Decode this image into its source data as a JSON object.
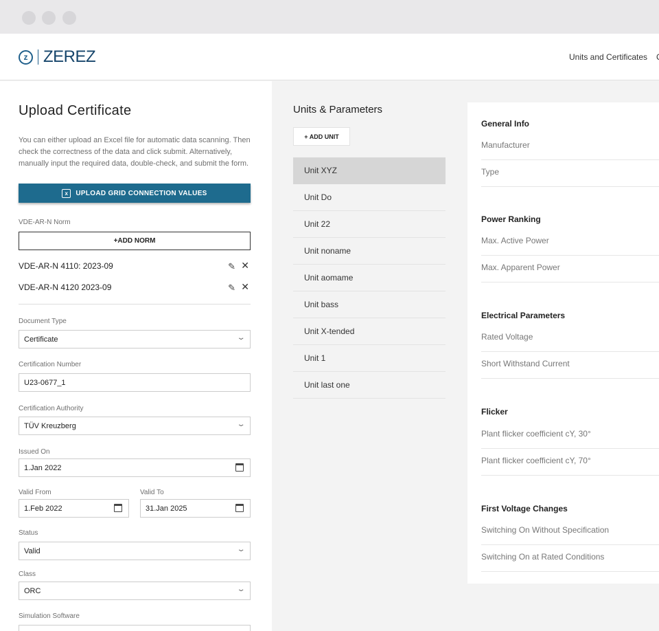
{
  "brand": {
    "logo_mark": "z",
    "name": "ZEREZ"
  },
  "nav": {
    "units_link": "Units and Certificates",
    "next_link": "C"
  },
  "upload": {
    "title": "Upload Certificate",
    "description": "You can either upload an Excel file for automatic data scanning. Then check the correctness of the data and click submit. Alternatively, manually input the required data, double-check, and submit the form.",
    "upload_button": "UPLOAD GRID CONNECTION VALUES",
    "norm_label": "VDE-AR-N Norm",
    "add_norm_button": "+ADD NORM",
    "norms": [
      "VDE-AR-N 4110: 2023-09",
      "VDE-AR-N 4120 2023-09"
    ],
    "document_type": {
      "label": "Document Type",
      "value": "Certificate"
    },
    "certification_number": {
      "label": "Certification Number",
      "value": "U23-0677_1"
    },
    "certification_authority": {
      "label": "Certification Authority",
      "value": "TÜV Kreuzberg"
    },
    "issued_on": {
      "label": "Issued On",
      "value": "1.Jan 2022"
    },
    "valid_from": {
      "label": "Valid From",
      "value": "1.Feb 2022"
    },
    "valid_to": {
      "label": "Valid To",
      "value": "31.Jan 2025"
    },
    "status": {
      "label": "Status",
      "value": "Valid"
    },
    "class": {
      "label": "Class",
      "value": "ORC"
    },
    "simulation_software": {
      "label": "Simulation Software",
      "value": ""
    }
  },
  "units": {
    "title": "Units & Parameters",
    "add_unit_button": "+ ADD UNIT",
    "items": [
      "Unit XYZ",
      "Unit Do",
      "Unit 22",
      "Unit noname",
      "Unit aomame",
      "Unit bass",
      "Unit X-tended",
      "Unit 1",
      "Unit last one"
    ],
    "selected": "Unit XYZ"
  },
  "info": {
    "sections": [
      {
        "title": "General Info",
        "rows": [
          "Manufacturer",
          "Type"
        ]
      },
      {
        "title": "Power Ranking",
        "rows": [
          "Max. Active Power",
          "Max. Apparent Power"
        ]
      },
      {
        "title": "Electrical Parameters",
        "rows": [
          "Rated Voltage",
          "Short Withstand Current"
        ]
      },
      {
        "title": "Flicker",
        "rows": [
          "Plant flicker coefficient cY, 30°",
          "Plant flicker coefficient cY, 70°"
        ]
      },
      {
        "title": "First Voltage Changes",
        "rows": [
          "Switching On Without Specification",
          "Switching On at Rated Conditions"
        ]
      }
    ]
  },
  "icons": {
    "excel": "excel-icon",
    "edit": "pencil-icon",
    "remove": "close-icon",
    "dropdown": "chevron-down-icon",
    "date": "calendar-icon"
  },
  "colors": {
    "primary": "#1e6b8e",
    "brand": "#16456b",
    "selected": "#d6d6d6"
  }
}
